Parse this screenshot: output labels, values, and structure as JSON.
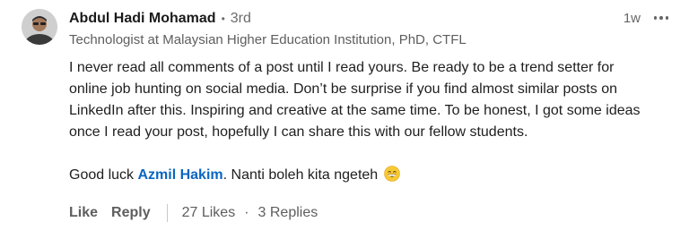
{
  "comment": {
    "author": {
      "name": "Abdul Hadi Mohamad",
      "dot": "•",
      "degree": "3rd",
      "headline": "Technologist at Malaysian Higher Education Institution, PhD, CTFL"
    },
    "time": "1w",
    "more_icon": "more-horizontal-icon",
    "paragraph1": "I never read all comments of a post until I read yours. Be ready to be a trend setter for online job hunting on social media. Don’t be surprise if you find almost similar posts on LinkedIn after this. Inspiring and creative at the same time. To be honest, I got some ideas once I read your post, hopefully I can share this with our fellow students.",
    "paragraph2_prefix": "Good luck ",
    "mention": "Azmil Hakim",
    "paragraph2_suffix": ". Nanti boleh kita ngeteh",
    "emoji_icon": "grinning-face-icon",
    "actions": {
      "like_label": "Like",
      "reply_label": "Reply",
      "likes_count": "27 Likes",
      "separator": "·",
      "replies_count": "3 Replies"
    }
  },
  "colors": {
    "mention": "#0a66c2",
    "secondary_text": "#5e5e5e",
    "primary_text": "#1e1e1e"
  }
}
